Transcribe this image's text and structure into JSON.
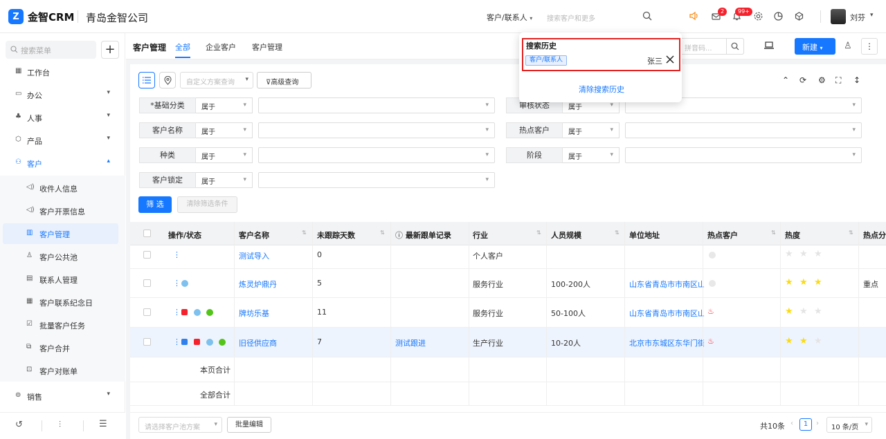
{
  "app": {
    "logo_letter": "Z",
    "name": "金智CRM",
    "company": "青岛金智公司"
  },
  "topbar": {
    "search_type": "客户/联系人",
    "search_placeholder": "搜索客户和更多",
    "badge_mail": "2",
    "badge_bell": "99+",
    "username": "刘芬"
  },
  "sidebar": {
    "search_placeholder": "搜索菜单",
    "plus": "+",
    "items": [
      {
        "label": "工作台"
      },
      {
        "label": "办公"
      },
      {
        "label": "人事"
      },
      {
        "label": "产品"
      },
      {
        "label": "客户"
      }
    ],
    "sub_items": [
      {
        "label": "收件人信息"
      },
      {
        "label": "客户开票信息"
      },
      {
        "label": "客户管理"
      },
      {
        "label": "客户公共池"
      },
      {
        "label": "联系人管理"
      },
      {
        "label": "客户联系纪念日"
      },
      {
        "label": "批量客户任务"
      },
      {
        "label": "客户合并"
      },
      {
        "label": "客户对账单"
      }
    ],
    "sales": "销售"
  },
  "tabs": {
    "crumb": "客户管理",
    "items": [
      "全部",
      "企业客户",
      "客户管理"
    ]
  },
  "toolbar": {
    "scheme_placeholder": "自定义方案查询",
    "advanced": "高级查询",
    "pinyin_placeholder": "拼音码...",
    "new_button": "新建"
  },
  "filters": [
    {
      "label": "*基础分类",
      "op": "属于"
    },
    {
      "label": "客户名称",
      "op": "属于"
    },
    {
      "label": "种类",
      "op": "属于"
    },
    {
      "label": "客户锁定",
      "op": "属于"
    },
    {
      "label": "审核状态",
      "op": "属于"
    },
    {
      "label": "热点客户",
      "op": "属于"
    },
    {
      "label": "阶段",
      "op": "属于"
    }
  ],
  "filter_buttons": {
    "apply": "筛 选",
    "clear": "清除筛选条件"
  },
  "table": {
    "headers": [
      "操作/状态",
      "客户名称",
      "未跟踪天数",
      "最新跟单记录",
      "行业",
      "人员规模",
      "单位地址",
      "热点客户",
      "热度",
      "热点分"
    ],
    "rows": [
      {
        "name": "测试导入",
        "days": "0",
        "record": "",
        "industry": "个人客户",
        "scale": "",
        "address": "",
        "hot": "none",
        "rating": 0,
        "hot_note": ""
      },
      {
        "name": "炼灵炉鼎丹",
        "days": "5",
        "record": "",
        "industry": "服务行业",
        "scale": "100-200人",
        "address": "山东省青岛市市南区山",
        "hot": "none",
        "rating": 3,
        "hot_note": "重点"
      },
      {
        "name": "牌坊乐基",
        "days": "11",
        "record": "",
        "industry": "服务行业",
        "scale": "50-100人",
        "address": "山东省青岛市市南区山",
        "hot": "fire",
        "rating": 1,
        "hot_note": ""
      },
      {
        "name": "旧径供应商",
        "days": "7",
        "record": "测试跟进",
        "industry": "生产行业",
        "scale": "10-20人",
        "address": "北京市东城区东华门街",
        "hot": "fire",
        "rating": 2,
        "hot_note": ""
      }
    ],
    "page_total": "本页合计",
    "all_total": "全部合计"
  },
  "footer": {
    "pool_placeholder": "请选择客户池方案",
    "batch_edit": "批量编辑",
    "total": "共10条",
    "page": "1",
    "page_size": "10 条/页"
  },
  "popup": {
    "title": "搜索历史",
    "tag": "客户/联系人",
    "name": "张三",
    "clear": "清除搜索历史"
  }
}
